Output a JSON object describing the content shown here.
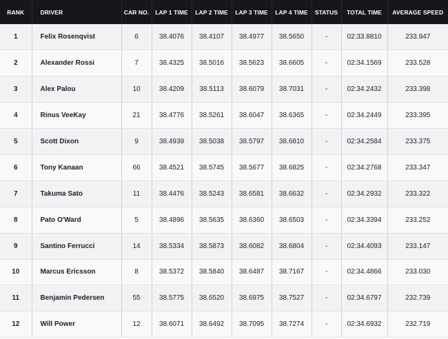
{
  "table": {
    "columns": [
      "RANK",
      "DRIVER",
      "CAR NO.",
      "LAP 1 TIME",
      "LAP 2 TIME",
      "LAP 3 TIME",
      "LAP 4 TIME",
      "STATUS",
      "TOTAL TIME",
      "AVERAGE SPEED"
    ],
    "rows": [
      {
        "rank": "1",
        "driver": "Felix Rosenqvist",
        "car": "6",
        "lap1": "38.4076",
        "lap2": "38.4107",
        "lap3": "38.4977",
        "lap4": "38.5650",
        "status": "-",
        "total": "02:33.8810",
        "speed": "233.947"
      },
      {
        "rank": "2",
        "driver": "Alexander Rossi",
        "car": "7",
        "lap1": "38.4325",
        "lap2": "38.5016",
        "lap3": "38.5623",
        "lap4": "38.6605",
        "status": "-",
        "total": "02:34.1569",
        "speed": "233.528"
      },
      {
        "rank": "3",
        "driver": "Alex Palou",
        "car": "10",
        "lap1": "38.4209",
        "lap2": "38.5113",
        "lap3": "38.6079",
        "lap4": "38.7031",
        "status": "-",
        "total": "02:34.2432",
        "speed": "233.398"
      },
      {
        "rank": "4",
        "driver": "Rinus VeeKay",
        "car": "21",
        "lap1": "38.4776",
        "lap2": "38.5261",
        "lap3": "38.6047",
        "lap4": "38.6365",
        "status": "-",
        "total": "02:34.2449",
        "speed": "233.395"
      },
      {
        "rank": "5",
        "driver": "Scott Dixon",
        "car": "9",
        "lap1": "38.4939",
        "lap2": "38.5038",
        "lap3": "38.5797",
        "lap4": "38.6810",
        "status": "-",
        "total": "02:34.2584",
        "speed": "233.375"
      },
      {
        "rank": "6",
        "driver": "Tony Kanaan",
        "car": "66",
        "lap1": "38.4521",
        "lap2": "38.5745",
        "lap3": "38.5677",
        "lap4": "38.6825",
        "status": "-",
        "total": "02:34.2768",
        "speed": "233.347"
      },
      {
        "rank": "7",
        "driver": "Takuma Sato",
        "car": "11",
        "lap1": "38.4476",
        "lap2": "38.5243",
        "lap3": "38.6581",
        "lap4": "38.6632",
        "status": "-",
        "total": "02:34.2932",
        "speed": "233.322"
      },
      {
        "rank": "8",
        "driver": "Pato O'Ward",
        "car": "5",
        "lap1": "38.4896",
        "lap2": "38.5635",
        "lap3": "38.6360",
        "lap4": "38.6503",
        "status": "-",
        "total": "02:34.3394",
        "speed": "233.252"
      },
      {
        "rank": "9",
        "driver": "Santino Ferrucci",
        "car": "14",
        "lap1": "38.5334",
        "lap2": "38.5873",
        "lap3": "38.6082",
        "lap4": "38.6804",
        "status": "-",
        "total": "02:34.4093",
        "speed": "233.147"
      },
      {
        "rank": "10",
        "driver": "Marcus Ericsson",
        "car": "8",
        "lap1": "38.5372",
        "lap2": "38.5840",
        "lap3": "38.6487",
        "lap4": "38.7167",
        "status": "-",
        "total": "02:34.4866",
        "speed": "233.030"
      },
      {
        "rank": "11",
        "driver": "Benjamin Pedersen",
        "car": "55",
        "lap1": "38.5775",
        "lap2": "38.6520",
        "lap3": "38.6975",
        "lap4": "38.7527",
        "status": "-",
        "total": "02:34.6797",
        "speed": "232.739"
      },
      {
        "rank": "12",
        "driver": "Will Power",
        "car": "12",
        "lap1": "38.6071",
        "lap2": "38.6492",
        "lap3": "38.7095",
        "lap4": "38.7274",
        "status": "-",
        "total": "02:34.6932",
        "speed": "232.719"
      }
    ]
  }
}
